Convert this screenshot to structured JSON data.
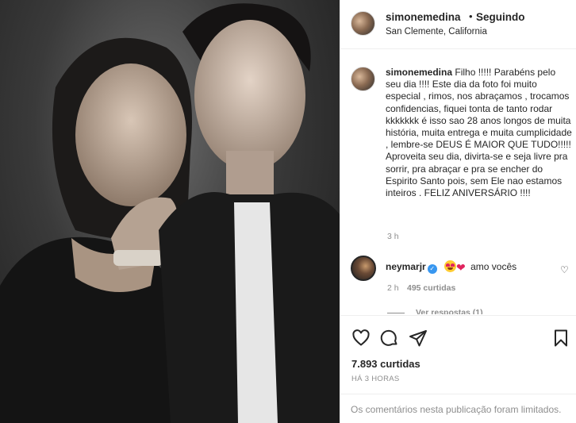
{
  "post": {
    "username": "simonemedina",
    "dot": "•",
    "follow_status": "Seguindo",
    "location": "San Clemente, California"
  },
  "caption": {
    "username": "simonemedina",
    "text": "Filho !!!!! Parabéns pelo seu dia !!!! Este dia da foto foi muito especial , rimos, nos abraçamos , trocamos confidencias, fiquei tonta de tanto rodar kkkkkkk é isso sao 28 anos longos de muita história, muita entrega e muita cumplicidade , lembre-se DEUS É MAIOR QUE TUDO!!!!! Aproveita seu dia, divirta-se e seja livre pra sorrir, pra abraçar e pra se encher do Espirito Santo pois, sem Ele nao estamos inteiros . FELIZ ANIVERSÁRIO !!!!",
    "time": "3 h"
  },
  "comment": {
    "username": "neymarjr",
    "verified_mark": "✓",
    "text": "amo vocês",
    "time": "2 h",
    "likes": "495 curtidas",
    "view_replies": "Ver respostas (1)"
  },
  "icons": {
    "like": "heart-icon",
    "comment": "comment-icon",
    "share": "share-icon",
    "save": "bookmark-icon",
    "comment_like": "small-heart-icon",
    "verified": "verified-badge-icon",
    "emoji_1": "heart-eyes-emoji",
    "emoji_2": "red-heart-emoji"
  },
  "stats": {
    "likes": "7.893 curtidas",
    "date": "HÁ 3 HORAS"
  },
  "footer": {
    "limited_notice": "Os comentários nesta publicação foram limitados."
  },
  "colors": {
    "verified": "#3897f0",
    "secondary_text": "#8e8e8e",
    "heart": "#e0245e"
  }
}
